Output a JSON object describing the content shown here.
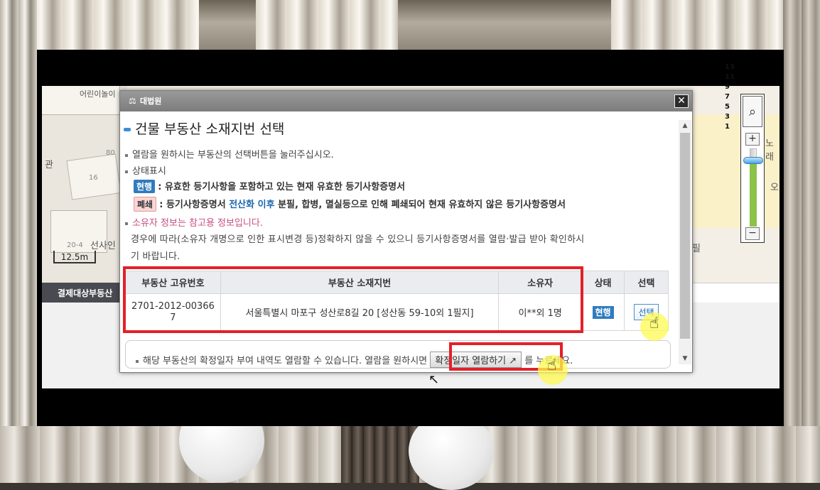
{
  "map": {
    "left_label": "어린이놀이",
    "label_gwan": "관",
    "num_80": "80",
    "num_16": "16",
    "num_204": "20-4",
    "label_seosain": "선사인",
    "scale": "12.5m",
    "bottom_tab": "결제대상부동산",
    "label_right_top": "노래",
    "label_right_mid": "오",
    "label_right_pil": "필",
    "zoom_levels": [
      "13",
      "11",
      "9",
      "7",
      "5",
      "3",
      "1"
    ],
    "zoom_in": "+",
    "zoom_out": "−",
    "zoom_level_fraction": 0.85
  },
  "dialog": {
    "logo_text": "대법원",
    "close_label": "✕",
    "heading": "건물 부동산 소재지번 선택",
    "instruction": "열람을 원하시는 부동산의 선택버튼을 눌러주십시오.",
    "status_label": "상태표시",
    "status_current_badge": "현행",
    "status_current_text": ": 유효한 등기사항을 포함하고 있는 현재 유효한 등기사항증명서",
    "status_closed_badge": "폐쇄",
    "status_closed_text_a": ": 등기사항증명서 ",
    "status_closed_text_b": "전산화 이후",
    "status_closed_text_c": " 분필, 합병, 멸실등으로 인해 폐쇄되어 현재 유효하지 않은 등기사항증명서",
    "owner_notice": "소유자 정보는 참고용 정보입니다.",
    "owner_note_1": "경우에 따라(소유자 개명으로 인한 표시변경 등)정확하지 않을 수 있으니 등기사항증명서를 열람·발급 받아 확인하시",
    "owner_note_2": "기 바랍니다.",
    "table": {
      "headers": [
        "부동산 고유번호",
        "부동산 소재지번",
        "소유자",
        "상태",
        "선택"
      ],
      "rows": [
        {
          "id_line1": "2701-2012-00366",
          "id_line2": "7",
          "address": "서울특별시 마포구 성산로8길 20 [성산동 59-10외 1필지]",
          "owner": "이**외 1명",
          "state": "현행",
          "select": "선택"
        }
      ]
    },
    "info_prefix": "해당 부동산의 확정일자 부여 내역도 열람할 수 있습니다. 열람을 원하시면",
    "info_button": "확정일자 열람하기",
    "info_suffix": "를 누르세요."
  },
  "colors": {
    "highlight_red": "#e3202a",
    "badge_blue": "#2f7bbf",
    "cursor_highlight": "#fff550"
  }
}
